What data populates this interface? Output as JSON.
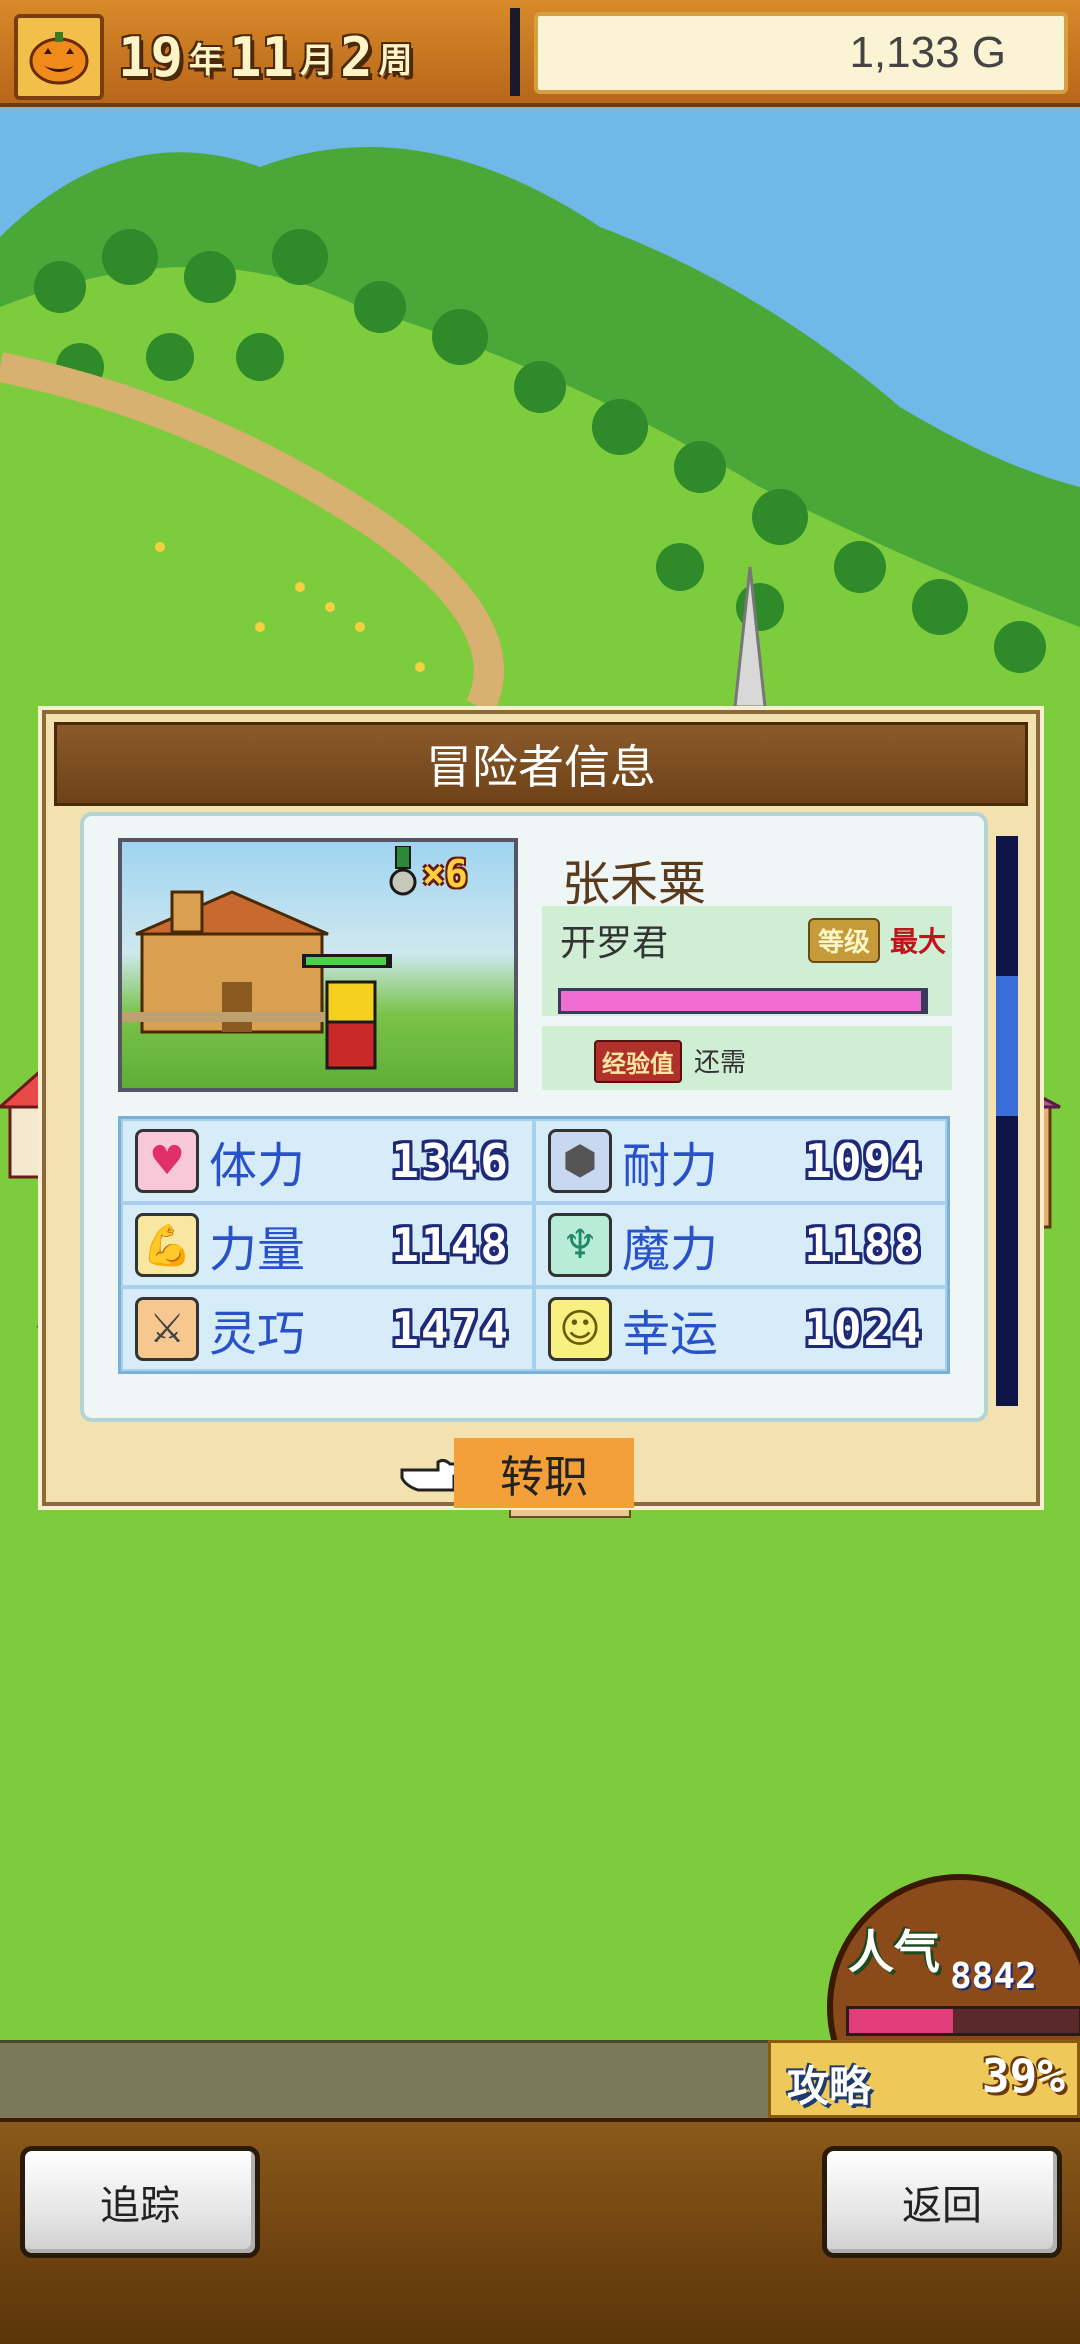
{
  "topbar": {
    "year": "19",
    "year_unit": "年",
    "month": "11",
    "month_unit": "月",
    "week": "2",
    "week_unit": "周",
    "gold": "1,133 G"
  },
  "dialog": {
    "title": "冒险者信息",
    "hero": {
      "name": "张禾粟",
      "class": "开罗君",
      "level_label": "等级",
      "level_value": "最大",
      "exp_label": "经验值",
      "exp_value": "还需",
      "medal_count": "×6",
      "hp_fraction": 0.99
    },
    "stats": [
      {
        "label": "体力",
        "value": "1346",
        "icon": "heart-icon",
        "color": "#f7c8d8"
      },
      {
        "label": "耐力",
        "value": "1094",
        "icon": "shield-icon",
        "color": "#c8d8f0"
      },
      {
        "label": "力量",
        "value": "1148",
        "icon": "muscle-icon",
        "color": "#f8e7a0"
      },
      {
        "label": "魔力",
        "value": "1188",
        "icon": "crystal-icon",
        "color": "#b8ecd8"
      },
      {
        "label": "灵巧",
        "value": "1474",
        "icon": "crossed-swords-icon",
        "color": "#f6c890"
      },
      {
        "label": "幸运",
        "value": "1024",
        "icon": "smiley-icon",
        "color": "#f8f080"
      }
    ],
    "job_change_label": "转职"
  },
  "popularity": {
    "label": "人气",
    "value": "8842",
    "fill": 0.45
  },
  "strategy": {
    "label": "攻略",
    "value": "39%"
  },
  "buttons": {
    "track": "追踪",
    "back": "返回"
  }
}
